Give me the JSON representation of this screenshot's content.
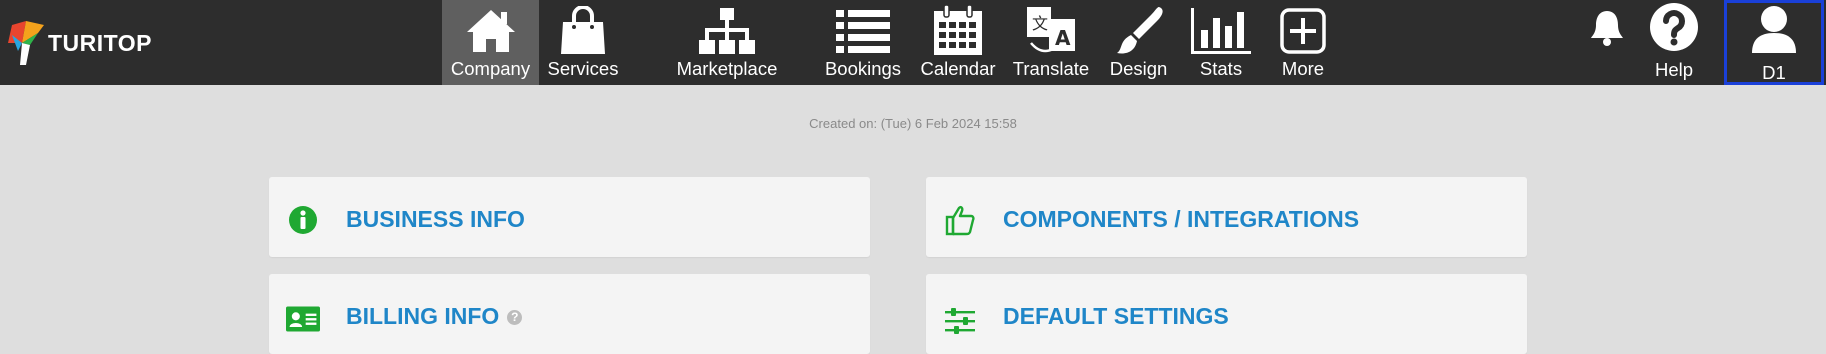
{
  "brand": {
    "name": "TURITOP"
  },
  "nav": {
    "items": [
      {
        "label": "Company",
        "icon": "home-icon",
        "active": true
      },
      {
        "label": "Services",
        "icon": "shopping-bag-icon"
      },
      {
        "label": "Marketplace",
        "icon": "sitemap-icon"
      },
      {
        "label": "Bookings",
        "icon": "list-icon"
      },
      {
        "label": "Calendar",
        "icon": "calendar-icon"
      },
      {
        "label": "Translate",
        "icon": "translate-icon"
      },
      {
        "label": "Design",
        "icon": "paintbrush-icon"
      },
      {
        "label": "Stats",
        "icon": "bar-chart-icon"
      },
      {
        "label": "More",
        "icon": "plus-square-icon"
      }
    ]
  },
  "header_right": {
    "help_label": "Help",
    "user_label": "D1"
  },
  "main": {
    "created_on": "Created on: (Tue) 6 Feb 2024 15:58",
    "cards": [
      {
        "title": "BUSINESS INFO",
        "icon": "info-circle-icon"
      },
      {
        "title": "COMPONENTS / INTEGRATIONS",
        "icon": "thumbs-up-icon"
      },
      {
        "title": "BILLING INFO",
        "icon": "id-card-icon"
      },
      {
        "title": "DEFAULT SETTINGS",
        "icon": "sliders-icon"
      }
    ]
  },
  "colors": {
    "topbar": "#2d2d2d",
    "active_nav": "#5f5f5f",
    "card_title": "#1f86c8",
    "icon_green": "#1fa832",
    "focus_border": "#1a40d8"
  }
}
